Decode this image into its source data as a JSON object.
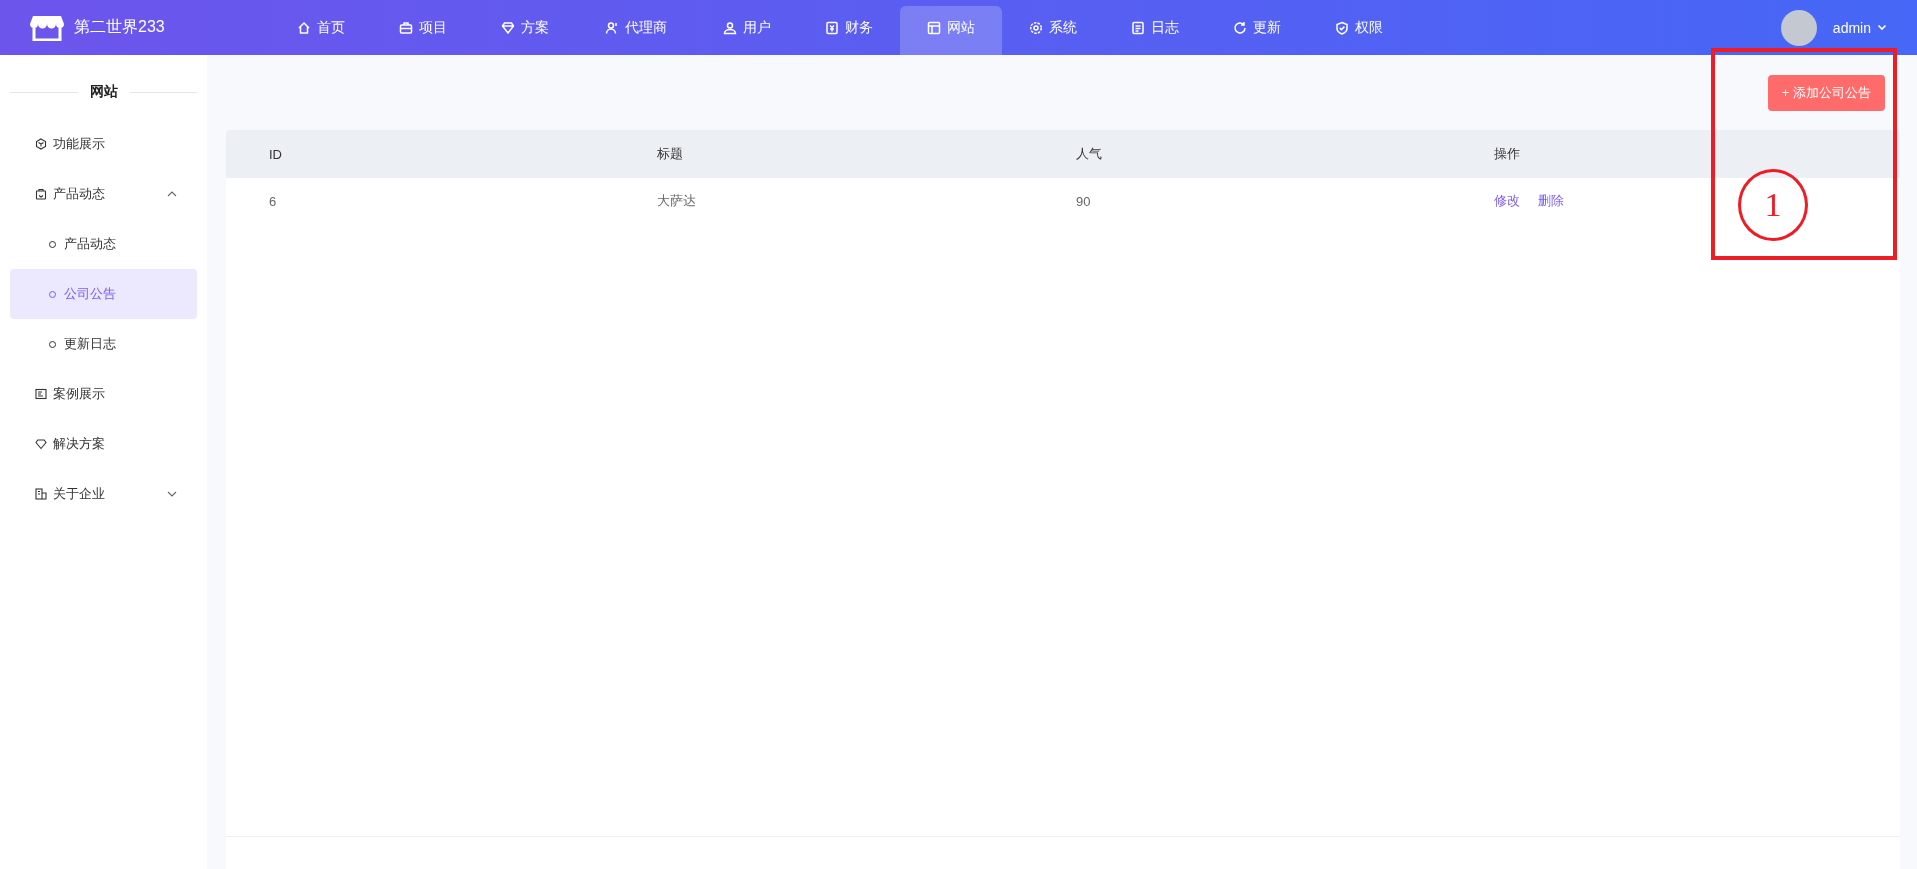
{
  "brand": {
    "name": "第二世界233"
  },
  "nav": [
    {
      "label": "首页",
      "selected": false
    },
    {
      "label": "项目",
      "selected": false
    },
    {
      "label": "方案",
      "selected": false
    },
    {
      "label": "代理商",
      "selected": false
    },
    {
      "label": "用户",
      "selected": false
    },
    {
      "label": "财务",
      "selected": false
    },
    {
      "label": "网站",
      "selected": true
    },
    {
      "label": "系统",
      "selected": false
    },
    {
      "label": "日志",
      "selected": false
    },
    {
      "label": "更新",
      "selected": false
    },
    {
      "label": "权限",
      "selected": false
    }
  ],
  "user": {
    "name": "admin"
  },
  "sidebar": {
    "title": "网站",
    "items": [
      {
        "label": "功能展示",
        "selected": false
      },
      {
        "label": "产品动态",
        "expanded": true,
        "selected": false,
        "children": [
          {
            "label": "产品动态",
            "selected": false
          },
          {
            "label": "公司公告",
            "selected": true
          },
          {
            "label": "更新日志",
            "selected": false
          }
        ]
      },
      {
        "label": "案例展示",
        "selected": false
      },
      {
        "label": "解决方案",
        "selected": false
      },
      {
        "label": "关于企业",
        "expanded": false,
        "selected": false
      }
    ]
  },
  "toolbar": {
    "add_button": "+ 添加公司公告"
  },
  "table": {
    "columns": [
      "ID",
      "标题",
      "人气",
      "操作"
    ],
    "rows": [
      {
        "id": "6",
        "title": "大萨达",
        "views": "90",
        "actions": [
          "修改",
          "删除"
        ]
      }
    ]
  },
  "annotation": {
    "label": "1"
  }
}
